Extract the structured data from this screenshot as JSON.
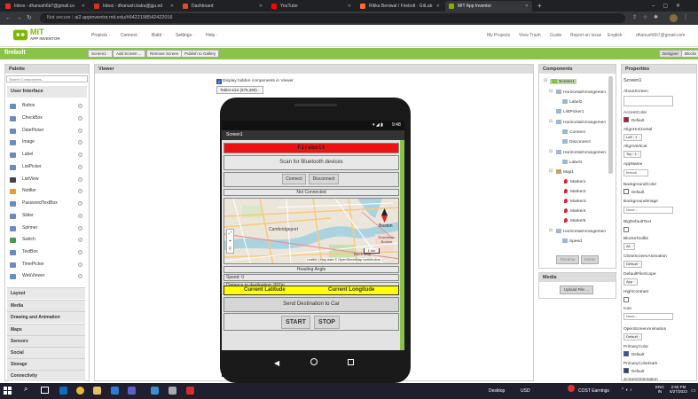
{
  "browser": {
    "tabs": [
      {
        "label": "Inbox - dhanush6b7@gmail.co",
        "color": "#d93025"
      },
      {
        "label": "Inbox - dhanush.babu@jgu.ed",
        "color": "#d93025"
      },
      {
        "label": "Dashboard",
        "color": "#e34c26"
      },
      {
        "label": "YouTube",
        "color": "#ff0000"
      },
      {
        "label": "Ritika Beniwal / Firebolt · GitLab",
        "color": "#fc6d26"
      },
      {
        "label": "MIT App Inventor",
        "color": "#7db800"
      }
    ],
    "new_tab": "+",
    "security": "Not secure",
    "url": "ai2.appinventor.mit.edu/#6422198542422016"
  },
  "app": {
    "brand": "MIT",
    "brand_sub": "APP INVENTOR",
    "menu": [
      "Projects ·",
      "Connect ·",
      "Build ·",
      "Settings ·",
      "Help ·"
    ],
    "right_menu": [
      "My Projects",
      "View Trash",
      "Guide",
      "Report an Issue",
      "English ·",
      "dhanush6b7@gmail.com ·"
    ],
    "project_name": "firebolt",
    "project_buttons": [
      "Screen1 ·",
      "Add Screen ...",
      "Remove Screen",
      "Publish to Gallery"
    ],
    "mode_buttons": [
      "Designer",
      "Blocks"
    ]
  },
  "palette": {
    "title": "Palette",
    "search_placeholder": "Search Components...",
    "category": "User Interface",
    "items": [
      "Button",
      "CheckBox",
      "DatePicker",
      "Image",
      "Label",
      "ListPicker",
      "ListView",
      "Notifier",
      "PasswordTextBox",
      "Slider",
      "Spinner",
      "Switch",
      "TextBox",
      "TimePicker",
      "WebViewer"
    ],
    "categories": [
      "Layout",
      "Media",
      "Drawing and Animation",
      "Maps",
      "Sensors",
      "Social",
      "Storage",
      "Connectivity"
    ]
  },
  "viewer": {
    "title": "Viewer",
    "hidden_label": "Display hidden components in Viewer",
    "size_select": "Tablet size (675,480) ·",
    "status_time": "9:48",
    "screen_title": "Screen1",
    "firebolt_label": "Firebolt",
    "scan_button": "Scan for Bluetooth devices",
    "connect_button": "Connect",
    "disconnect_button": "Disconnect",
    "status": "Not Connected",
    "map_labels": [
      "Cambridgeport",
      "Boston",
      "Downtown Boston",
      "Back Bay",
      "1 km"
    ],
    "map_attrib": "Leaflet | Map data © OpenStreetMap contributors",
    "heading": "Heading Angle",
    "speed": "Speed: 0",
    "distance": "Distance to destination: 997m",
    "lat_label": "Current Latitude",
    "lon_label": "Current Longitude",
    "send_button": "Send Destination to Car",
    "start_button": "START",
    "stop_button": "STOP"
  },
  "components": {
    "title": "Components",
    "tree": [
      {
        "label": "Screen1",
        "level": 0,
        "icon": "screen"
      },
      {
        "label": "HorizontalArrangemen",
        "level": 1,
        "icon": "box"
      },
      {
        "label": "Label2",
        "level": 2,
        "icon": "box"
      },
      {
        "label": "ListPicker1",
        "level": 1,
        "icon": "box"
      },
      {
        "label": "HorizontalArrangemen",
        "level": 1,
        "icon": "box"
      },
      {
        "label": "Connect",
        "level": 2,
        "icon": "box"
      },
      {
        "label": "Disconnect",
        "level": 2,
        "icon": "box"
      },
      {
        "label": "HorizontalArrangemen",
        "level": 1,
        "icon": "box"
      },
      {
        "label": "Label1",
        "level": 2,
        "icon": "box"
      },
      {
        "label": "Map1",
        "level": 1,
        "icon": "map"
      },
      {
        "label": "Marker1",
        "level": 2,
        "icon": "marker"
      },
      {
        "label": "Marker2",
        "level": 2,
        "icon": "marker"
      },
      {
        "label": "Marker3",
        "level": 2,
        "icon": "marker"
      },
      {
        "label": "Marker4",
        "level": 2,
        "icon": "marker"
      },
      {
        "label": "Marker5",
        "level": 2,
        "icon": "marker"
      },
      {
        "label": "HorizontalArrangemen",
        "level": 1,
        "icon": "box"
      },
      {
        "label": "Speed",
        "level": 2,
        "icon": "box"
      }
    ],
    "rename_button": "Rename",
    "delete_button": "Delete",
    "media_title": "Media",
    "upload_button": "Upload File ..."
  },
  "properties": {
    "title": "Properties",
    "component": "Screen1",
    "about_label": "AboutScreen",
    "accent_label": "AccentColor",
    "accent_value": "Default",
    "alignh_label": "AlignHorizontal",
    "alignh_value": "Left : 1 ·",
    "alignv_label": "AlignVertical",
    "alignv_value": "Top : 1 ·",
    "appname_label": "AppName",
    "appname_value": "firebolt",
    "bgcolor_label": "BackgroundColor",
    "bgcolor_value": "Default",
    "bgimage_label": "BackgroundImage",
    "bgimage_value": "None...",
    "bigdefault_label": "BigDefaultText",
    "blockstoolkit_label": "BlocksToolkit",
    "blockstoolkit_value": "All ·",
    "closeanim_label": "CloseScreenAnimation",
    "closeanim_value": "Default ·",
    "defaultfile_label": "DefaultFileScope",
    "defaultfile_value": "App ·",
    "highcontrast_label": "HighContrast",
    "icon_label": "Icon",
    "icon_value": "None...",
    "openanim_label": "OpenScreenAnimation",
    "openanim_value": "Default ·",
    "primary_label": "PrimaryColor",
    "primary_value": "Default",
    "primarydark_label": "PrimaryColorDark",
    "primarydark_value": "Default",
    "orientation_label": "ScreenOrientation"
  },
  "taskbar": {
    "desktop": "Desktop",
    "currency": "USD",
    "cost": "COST Earnings",
    "lang": "ENG",
    "region": "IN",
    "time": "2:50 PM",
    "date": "5/27/2022"
  },
  "colors": {
    "accent": "#8bc34a",
    "firebolt_red": "#ee1111",
    "coord_yellow": "#ffff00",
    "accent_swatch": "#c8102e",
    "primary_swatch": "#3f51b5",
    "primarydark_swatch": "#303f9f"
  }
}
